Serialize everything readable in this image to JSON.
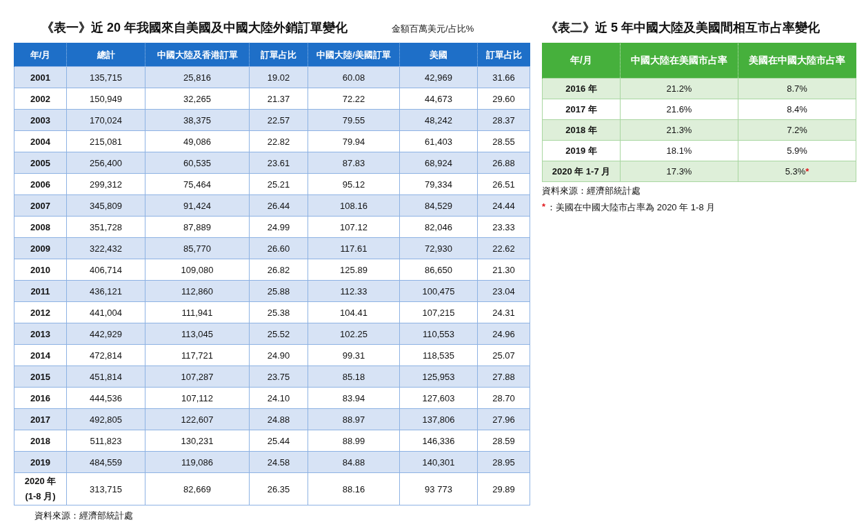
{
  "table1": {
    "title": "《表一》近 20 年我國來自美國及中國大陸外銷訂單變化",
    "unit": "金額百萬美元/占比%",
    "columns": [
      "年/月",
      "總計",
      "中國大陸及香港訂單",
      "訂單占比",
      "中國大陸/美國訂單",
      "美國",
      "訂單占比"
    ],
    "rows": [
      [
        "2001",
        "135,715",
        "25,816",
        "19.02",
        "60.08",
        "42,969",
        "31.66"
      ],
      [
        "2002",
        "150,949",
        "32,265",
        "21.37",
        "72.22",
        "44,673",
        "29.60"
      ],
      [
        "2003",
        "170,024",
        "38,375",
        "22.57",
        "79.55",
        "48,242",
        "28.37"
      ],
      [
        "2004",
        "215,081",
        "49,086",
        "22.82",
        "79.94",
        "61,403",
        "28.55"
      ],
      [
        "2005",
        "256,400",
        "60,535",
        "23.61",
        "87.83",
        "68,924",
        "26.88"
      ],
      [
        "2006",
        "299,312",
        "75,464",
        "25.21",
        "95.12",
        "79,334",
        "26.51"
      ],
      [
        "2007",
        "345,809",
        "91,424",
        "26.44",
        "108.16",
        "84,529",
        "24.44"
      ],
      [
        "2008",
        "351,728",
        "87,889",
        "24.99",
        "107.12",
        "82,046",
        "23.33"
      ],
      [
        "2009",
        "322,432",
        "85,770",
        "26.60",
        "117.61",
        "72,930",
        "22.62"
      ],
      [
        "2010",
        "406,714",
        "109,080",
        "26.82",
        "125.89",
        "86,650",
        "21.30"
      ],
      [
        "2011",
        "436,121",
        "112,860",
        "25.88",
        "112.33",
        "100,475",
        "23.04"
      ],
      [
        "2012",
        "441,004",
        "111,941",
        "25.38",
        "104.41",
        "107,215",
        "24.31"
      ],
      [
        "2013",
        "442,929",
        "113,045",
        "25.52",
        "102.25",
        "110,553",
        "24.96"
      ],
      [
        "2014",
        "472,814",
        "117,721",
        "24.90",
        "99.31",
        "118,535",
        "25.07"
      ],
      [
        "2015",
        "451,814",
        "107,287",
        "23.75",
        "85.18",
        "125,953",
        "27.88"
      ],
      [
        "2016",
        "444,536",
        "107,112",
        "24.10",
        "83.94",
        "127,603",
        "28.70"
      ],
      [
        "2017",
        "492,805",
        "122,607",
        "24.88",
        "88.97",
        "137,806",
        "27.96"
      ],
      [
        "2018",
        "511,823",
        "130,231",
        "25.44",
        "88.99",
        "146,336",
        "28.59"
      ],
      [
        "2019",
        "484,559",
        "119,086",
        "24.58",
        "84.88",
        "140,301",
        "28.95"
      ],
      [
        "2020 年 (1-8 月)",
        "313,715",
        "82,669",
        "26.35",
        "88.16",
        "93 773",
        "29.89"
      ]
    ],
    "source": "資料來源：經濟部統計處"
  },
  "table2": {
    "title": "《表二》近 5 年中國大陸及美國間相互市占率變化",
    "columns": [
      "年/月",
      "中國大陸在美國市占率",
      "美國在中國大陸市占率"
    ],
    "rows": [
      {
        "cells": [
          "2016 年",
          "21.2%",
          "8.7%"
        ]
      },
      {
        "cells": [
          "2017 年",
          "21.6%",
          "8.4%"
        ]
      },
      {
        "cells": [
          "2018 年",
          "21.3%",
          "7.2%"
        ]
      },
      {
        "cells": [
          "2019 年",
          "18.1%",
          "5.9%"
        ]
      },
      {
        "cells": [
          "2020 年 1-7 月",
          "17.3%",
          "5.3%"
        ],
        "note_mark": "*"
      }
    ],
    "source": "資料來源：經濟部統計處",
    "note": {
      "mark": "*",
      "text": "：美國在中國大陸市占率為 2020 年 1-8 月"
    }
  }
}
